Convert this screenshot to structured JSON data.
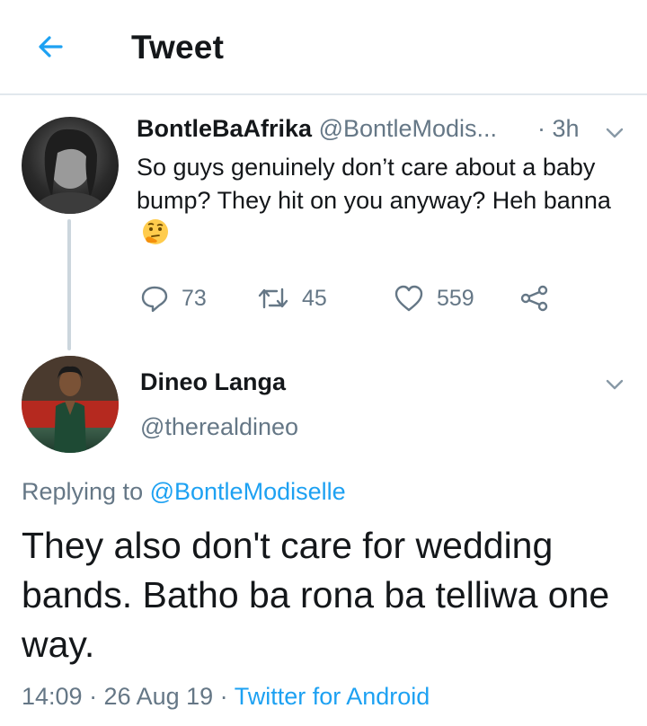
{
  "header": {
    "title": "Tweet",
    "back_icon": "arrow-left-icon",
    "accent": "#1da1f2"
  },
  "original_tweet": {
    "display_name": "BontleBaAfrika",
    "handle": "@BontleModis...",
    "time": "· 3h",
    "text": "So guys genuinely don’t care about a baby bump? They hit on you anyway? Heh banna",
    "emoji": "thinking-face-icon",
    "actions": {
      "replies": "73",
      "retweets": "45",
      "likes": "559"
    }
  },
  "reply_tweet": {
    "display_name": "Dineo Langa",
    "handle": "@therealdineo",
    "replying_prefix": "Replying to",
    "replying_to": "@BontleModiselle",
    "text": "They also don't care for wedding bands. Batho ba rona ba telliwa one way.",
    "timestamp": "14:09 · 26 Aug 19 ·",
    "source": "Twitter for Android"
  },
  "colors": {
    "text": "#14171a",
    "muted": "#657786",
    "link": "#1da1f2",
    "divider": "#e1e8ed"
  }
}
